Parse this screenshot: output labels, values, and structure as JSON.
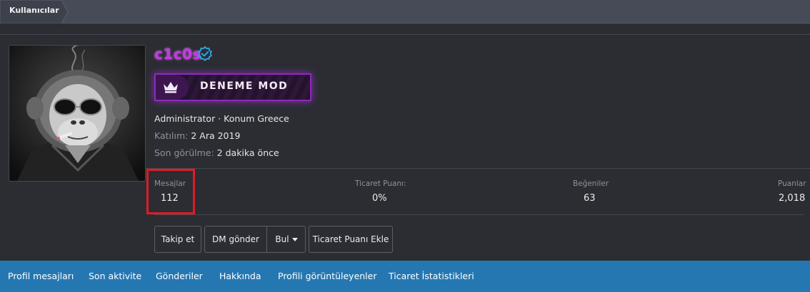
{
  "breadcrumb": {
    "label": "Kullanıcılar"
  },
  "profile": {
    "username": "c1c0s",
    "banner_label": "DENEME MOD",
    "info": {
      "role_location": "Administrator · Konum Greece",
      "joined_label": "Katılım:",
      "joined_value": "2 Ara 2019",
      "last_seen_label": "Son görülme:",
      "last_seen_value": "2 dakika önce"
    },
    "stats": [
      {
        "label": "Mesajlar",
        "value": "112"
      },
      {
        "label": "Ticaret Puanı:",
        "value": "0%"
      },
      {
        "label": "Beğeniler",
        "value": "63"
      },
      {
        "label": "Puanlar",
        "value": "2,018"
      }
    ],
    "actions": {
      "follow": "Takip et",
      "dm": "DM gönder",
      "find": "Bul",
      "add_trade": "Ticaret Puanı Ekle"
    }
  },
  "tabs": [
    "Profil mesajları",
    "Son aktivite",
    "Gönderiler",
    "Hakkında",
    "Profili görüntüleyenler",
    "Ticaret İstatistikleri"
  ],
  "colors": {
    "username": "#c23be0",
    "verified": "#2ea7e0",
    "banner_border": "#8a2bb8",
    "tab_bar": "#2577b1",
    "highlight": "#e01b24"
  },
  "icons": {
    "verified": "verified-badge-icon",
    "crown": "crown-icon",
    "caret": "caret-down-icon"
  }
}
